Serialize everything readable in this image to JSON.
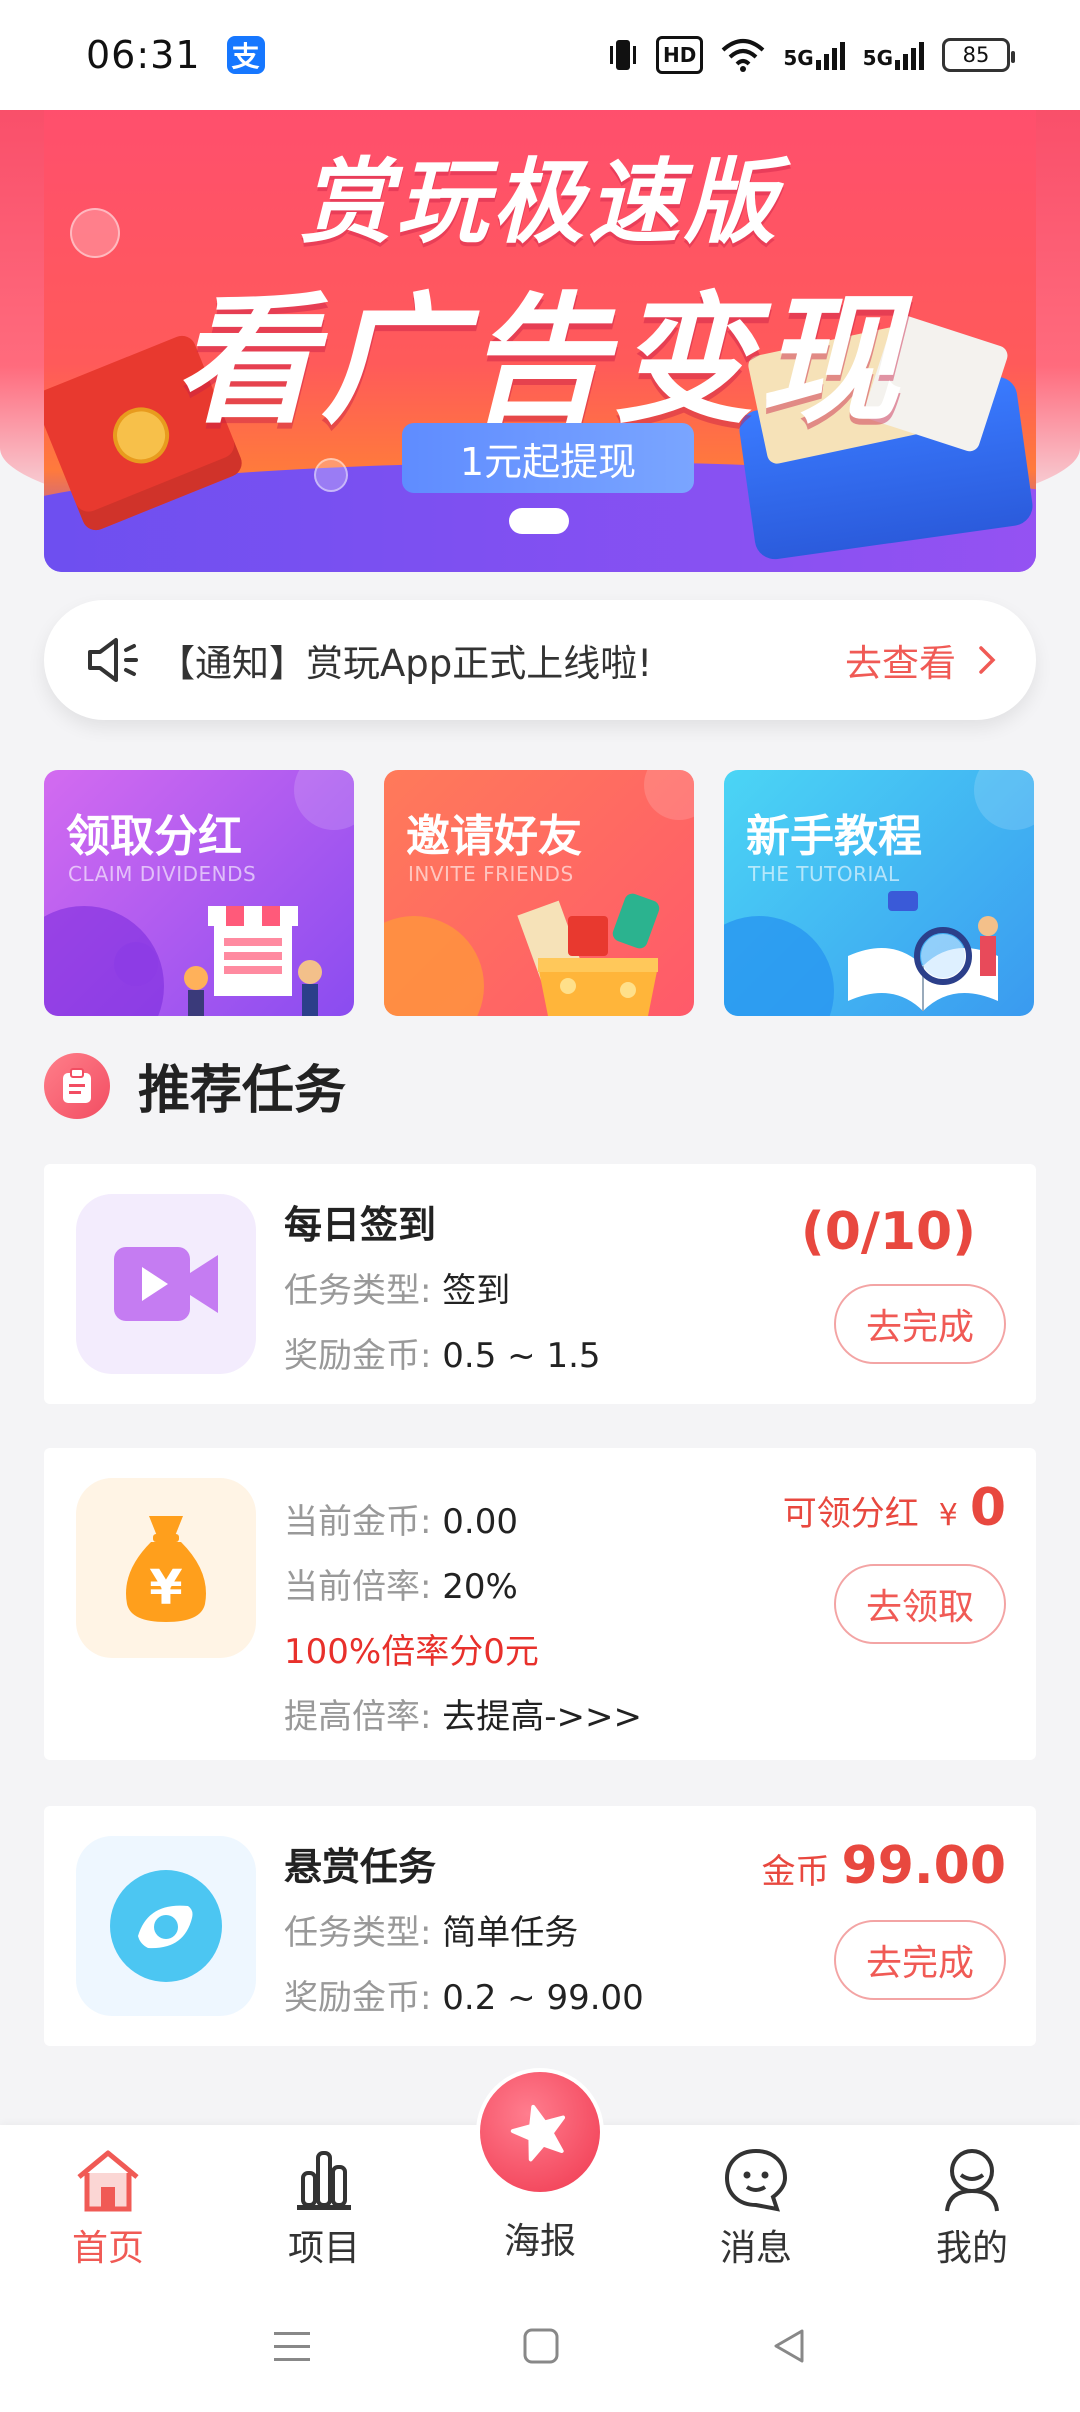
{
  "status_bar": {
    "time": "06:31",
    "alipay_glyph": "支",
    "hd_label": "HD",
    "net1": "5G",
    "net2": "5G",
    "battery": "85"
  },
  "banner": {
    "title_line1": "赏玩极速版",
    "title_line2": "看广告变现",
    "pill": "1元起提现"
  },
  "notice": {
    "icon": "speaker-icon",
    "text": "【通知】赏玩App正式上线啦!",
    "link": "去查看"
  },
  "tiles": [
    {
      "title": "领取分红",
      "subtitle": "CLAIM DIVIDENDS"
    },
    {
      "title": "邀请好友",
      "subtitle": "INVITE FRIENDS"
    },
    {
      "title": "新手教程",
      "subtitle": "THE TUTORIAL"
    }
  ],
  "section": {
    "title": "推荐任务"
  },
  "tasks": {
    "daily": {
      "title": "每日签到",
      "type_label": "任务类型:",
      "type_value": "签到",
      "reward_label": "奖励金币:",
      "reward_value": "0.5 ~ 1.5",
      "progress": "(0/10)",
      "button": "去完成"
    },
    "dividend": {
      "coins_label": "当前金币:",
      "coins_value": "0.00",
      "rate_label": "当前倍率:",
      "rate_value": "20%",
      "note": "100%倍率分0元",
      "boost_label": "提高倍率:",
      "boost_value": "去提高->>>",
      "claimable_label": "可领分红",
      "currency": "¥",
      "claimable_value": "0",
      "button": "去领取"
    },
    "bounty": {
      "title": "悬赏任务",
      "type_label": "任务类型:",
      "type_value": "简单任务",
      "reward_label": "奖励金币:",
      "reward_value": "0.2 ~ 99.00",
      "coin_label": "金币",
      "coin_value": "99.00",
      "button": "去完成"
    }
  },
  "tabbar": {
    "items": [
      {
        "label": "首页",
        "icon": "home-icon",
        "active": true
      },
      {
        "label": "项目",
        "icon": "project-icon",
        "active": false
      },
      {
        "label": "海报",
        "icon": "star-icon",
        "active": false
      },
      {
        "label": "消息",
        "icon": "message-icon",
        "active": false
      },
      {
        "label": "我的",
        "icon": "profile-icon",
        "active": false
      }
    ]
  },
  "colors": {
    "accent": "#f05a55",
    "brand_red": "#f94f6a"
  }
}
